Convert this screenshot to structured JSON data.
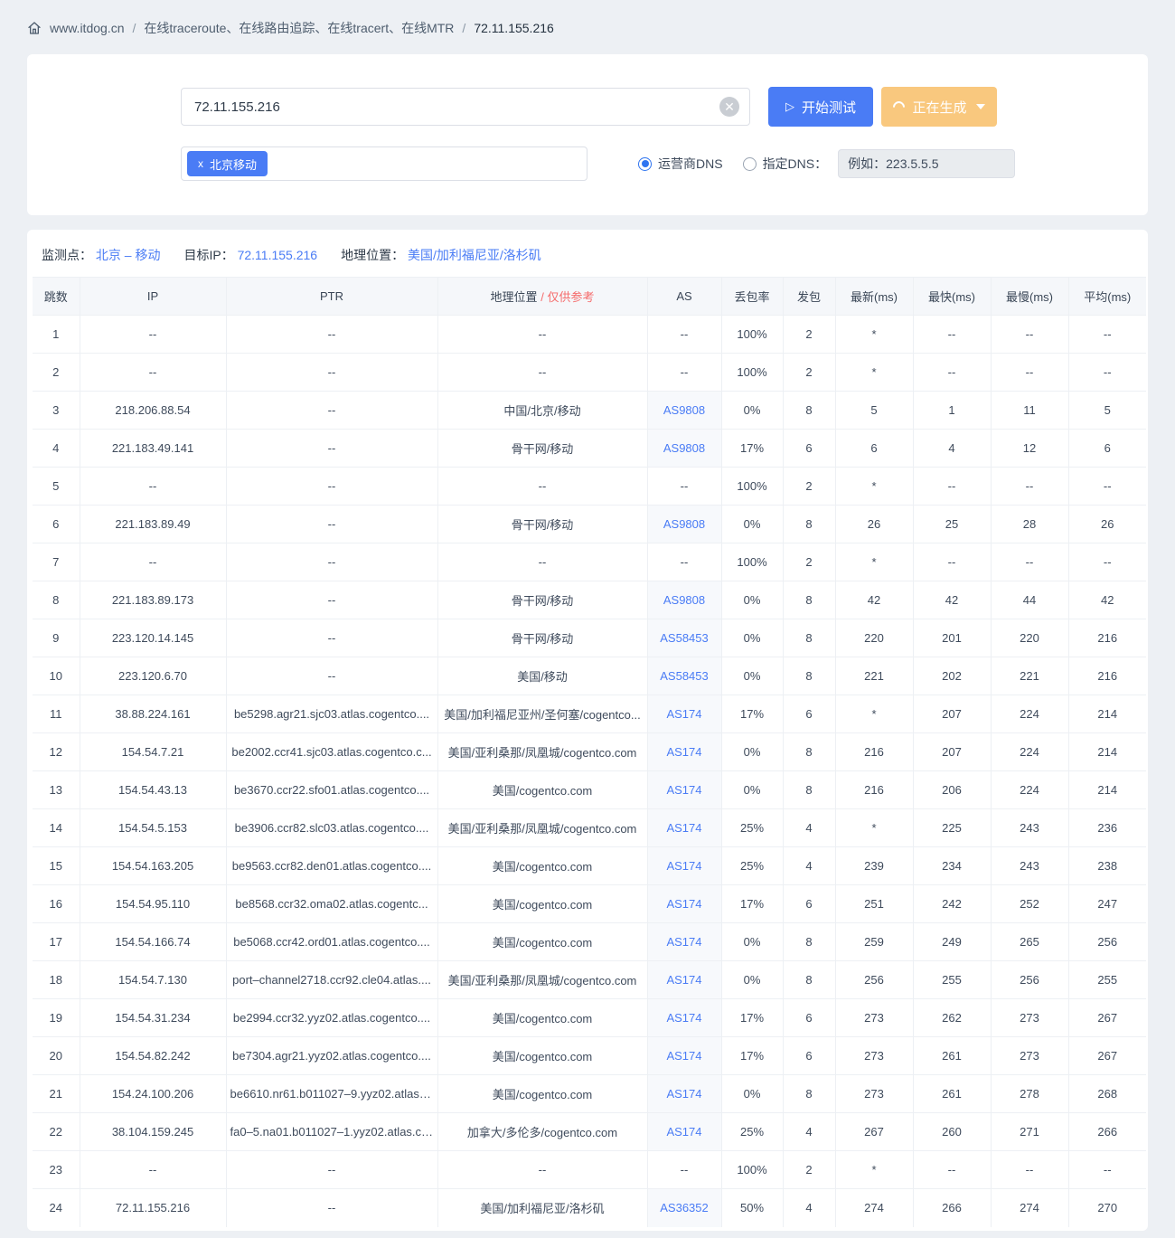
{
  "colors": {
    "primary_blue": "#4a7cf5",
    "warning_orange": "#f9c87e",
    "note_red": "#f56c6c",
    "page_background": "#edf0f4",
    "as_cell_background": "#f7f9fc"
  },
  "breadcrumb": {
    "home": "www.itdog.cn",
    "separator": "/",
    "path": "在线traceroute、在线路由追踪、在线tracert、在线MTR",
    "current": "72.11.155.216"
  },
  "search": {
    "target_value": "72.11.155.216",
    "start_button": "开始测试",
    "generating_button": "正在生成",
    "node_tag": "北京移动",
    "tag_remove": "x",
    "clear_glyph": "✕",
    "play_glyph": "▷",
    "dns_radio_isp": "运营商DNS",
    "dns_radio_custom": "指定DNS：",
    "dns_placeholder": "例如：223.5.5.5"
  },
  "result_info": {
    "monitor_label": "监测点：",
    "monitor_value": "北京 – 移动",
    "target_ip_label": "目标IP：",
    "target_ip_value": "72.11.155.216",
    "location_label": "地理位置：",
    "location_value": "美国/加利福尼亚/洛杉矶"
  },
  "table": {
    "headers": [
      "跳数",
      "IP",
      "PTR",
      "地理位置",
      "AS",
      "丢包率",
      "发包",
      "最新(ms)",
      "最快(ms)",
      "最慢(ms)",
      "平均(ms)"
    ],
    "location_note_separator": "/",
    "location_note": "仅供参考",
    "rows": [
      [
        "1",
        "--",
        "--",
        "--",
        "--",
        "100%",
        "2",
        "*",
        "--",
        "--",
        "--"
      ],
      [
        "2",
        "--",
        "--",
        "--",
        "--",
        "100%",
        "2",
        "*",
        "--",
        "--",
        "--"
      ],
      [
        "3",
        "218.206.88.54",
        "--",
        "中国/北京/移动",
        "AS9808",
        "0%",
        "8",
        "5",
        "1",
        "11",
        "5"
      ],
      [
        "4",
        "221.183.49.141",
        "--",
        "骨干网/移动",
        "AS9808",
        "17%",
        "6",
        "6",
        "4",
        "12",
        "6"
      ],
      [
        "5",
        "--",
        "--",
        "--",
        "--",
        "100%",
        "2",
        "*",
        "--",
        "--",
        "--"
      ],
      [
        "6",
        "221.183.89.49",
        "--",
        "骨干网/移动",
        "AS9808",
        "0%",
        "8",
        "26",
        "25",
        "28",
        "26"
      ],
      [
        "7",
        "--",
        "--",
        "--",
        "--",
        "100%",
        "2",
        "*",
        "--",
        "--",
        "--"
      ],
      [
        "8",
        "221.183.89.173",
        "--",
        "骨干网/移动",
        "AS9808",
        "0%",
        "8",
        "42",
        "42",
        "44",
        "42"
      ],
      [
        "9",
        "223.120.14.145",
        "--",
        "骨干网/移动",
        "AS58453",
        "0%",
        "8",
        "220",
        "201",
        "220",
        "216"
      ],
      [
        "10",
        "223.120.6.70",
        "--",
        "美国/移动",
        "AS58453",
        "0%",
        "8",
        "221",
        "202",
        "221",
        "216"
      ],
      [
        "11",
        "38.88.224.161",
        "be5298.agr21.sjc03.atlas.cogentco....",
        "美国/加利福尼亚州/圣何塞/cogentco...",
        "AS174",
        "17%",
        "6",
        "*",
        "207",
        "224",
        "214"
      ],
      [
        "12",
        "154.54.7.21",
        "be2002.ccr41.sjc03.atlas.cogentco.c...",
        "美国/亚利桑那/凤凰城/cogentco.com",
        "AS174",
        "0%",
        "8",
        "216",
        "207",
        "224",
        "214"
      ],
      [
        "13",
        "154.54.43.13",
        "be3670.ccr22.sfo01.atlas.cogentco....",
        "美国/cogentco.com",
        "AS174",
        "0%",
        "8",
        "216",
        "206",
        "224",
        "214"
      ],
      [
        "14",
        "154.54.5.153",
        "be3906.ccr82.slc03.atlas.cogentco....",
        "美国/亚利桑那/凤凰城/cogentco.com",
        "AS174",
        "25%",
        "4",
        "*",
        "225",
        "243",
        "236"
      ],
      [
        "15",
        "154.54.163.205",
        "be9563.ccr82.den01.atlas.cogentco....",
        "美国/cogentco.com",
        "AS174",
        "25%",
        "4",
        "239",
        "234",
        "243",
        "238"
      ],
      [
        "16",
        "154.54.95.110",
        "be8568.ccr32.oma02.atlas.cogentc...",
        "美国/cogentco.com",
        "AS174",
        "17%",
        "6",
        "251",
        "242",
        "252",
        "247"
      ],
      [
        "17",
        "154.54.166.74",
        "be5068.ccr42.ord01.atlas.cogentco....",
        "美国/cogentco.com",
        "AS174",
        "0%",
        "8",
        "259",
        "249",
        "265",
        "256"
      ],
      [
        "18",
        "154.54.7.130",
        "port–channel2718.ccr92.cle04.atlas....",
        "美国/亚利桑那/凤凰城/cogentco.com",
        "AS174",
        "0%",
        "8",
        "256",
        "255",
        "256",
        "255"
      ],
      [
        "19",
        "154.54.31.234",
        "be2994.ccr32.yyz02.atlas.cogentco....",
        "美国/cogentco.com",
        "AS174",
        "17%",
        "6",
        "273",
        "262",
        "273",
        "267"
      ],
      [
        "20",
        "154.54.82.242",
        "be7304.agr21.yyz02.atlas.cogentco....",
        "美国/cogentco.com",
        "AS174",
        "17%",
        "6",
        "273",
        "261",
        "273",
        "267"
      ],
      [
        "21",
        "154.24.100.206",
        "be6610.nr61.b011027–9.yyz02.atlas.c...",
        "美国/cogentco.com",
        "AS174",
        "0%",
        "8",
        "273",
        "261",
        "278",
        "268"
      ],
      [
        "22",
        "38.104.159.245",
        "fa0–5.na01.b011027–1.yyz02.atlas.co...",
        "加拿大/多伦多/cogentco.com",
        "AS174",
        "25%",
        "4",
        "267",
        "260",
        "271",
        "266"
      ],
      [
        "23",
        "--",
        "--",
        "--",
        "--",
        "100%",
        "2",
        "*",
        "--",
        "--",
        "--"
      ],
      [
        "24",
        "72.11.155.216",
        "--",
        "美国/加利福尼亚/洛杉矶",
        "AS36352",
        "50%",
        "4",
        "274",
        "266",
        "274",
        "270"
      ]
    ]
  }
}
